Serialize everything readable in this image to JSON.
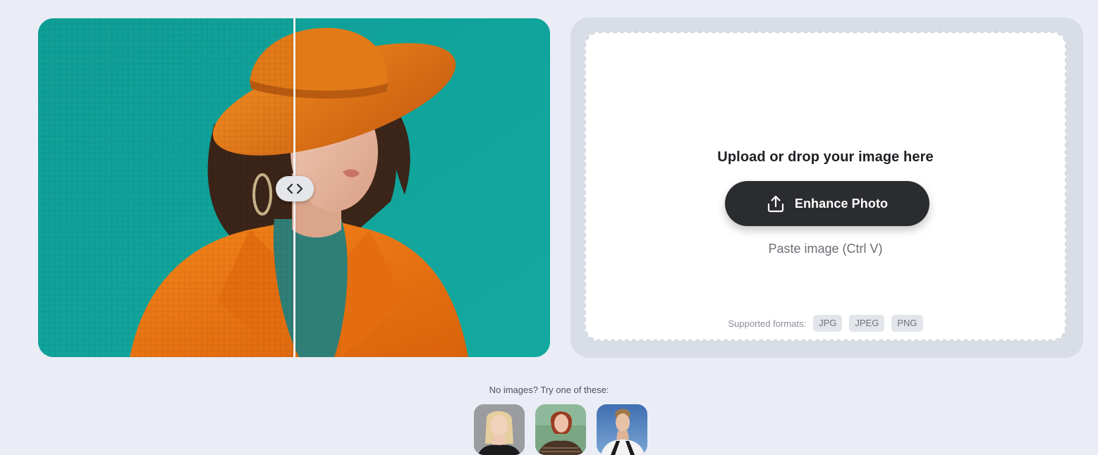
{
  "compare": {
    "image_alt": "Woman in orange hat and coat on teal background",
    "handle_icon": "chevron-left-right-icon"
  },
  "upload": {
    "title": "Upload or drop your image here",
    "button_label": "Enhance Photo",
    "button_icon": "upload-icon",
    "paste_hint": "Paste image (Ctrl V)",
    "formats_label": "Supported formats:",
    "formats": [
      "JPG",
      "JPEG",
      "PNG"
    ]
  },
  "samples": {
    "label": "No images? Try one of these:",
    "items": [
      {
        "name": "sample-blonde-woman"
      },
      {
        "name": "sample-redhead-woman"
      },
      {
        "name": "sample-man-blue-sky"
      }
    ]
  },
  "colors": {
    "page_bg": "#eaedf5",
    "teal": "#11a59c",
    "orange": "#ee7a12",
    "button_dark": "#2b2c2f"
  }
}
